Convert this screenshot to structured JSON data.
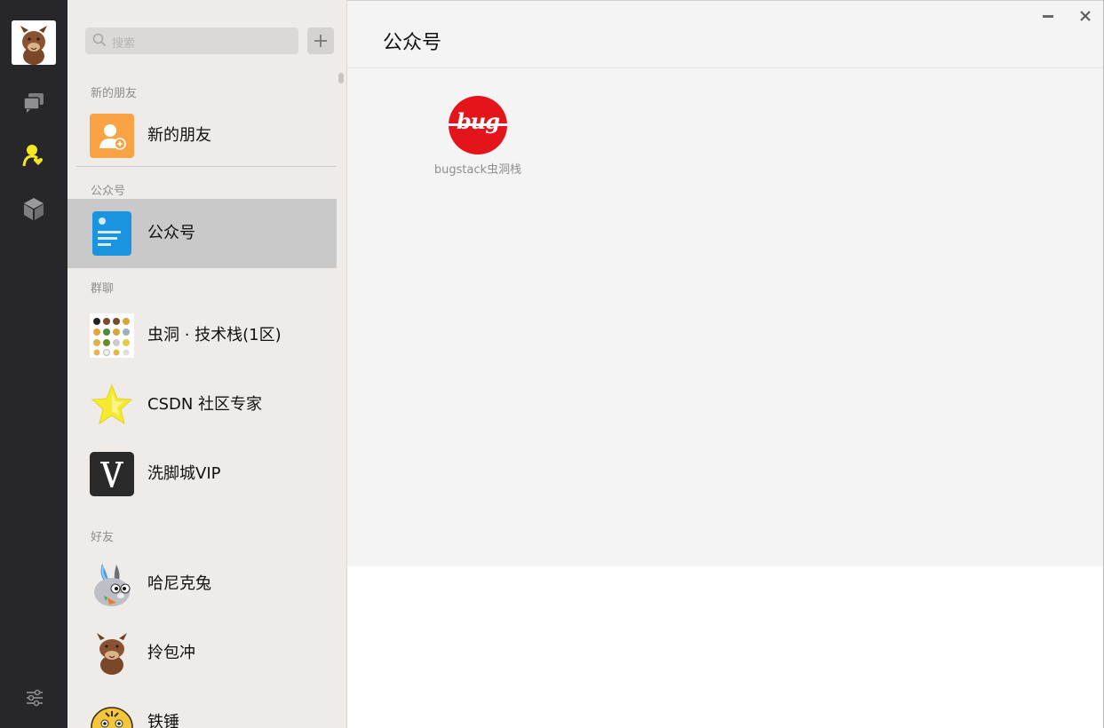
{
  "nav": {
    "items": [
      {
        "icon": "chat-bubbles-icon",
        "active": false
      },
      {
        "icon": "contacts-icon",
        "active": true
      },
      {
        "icon": "cube-icon",
        "active": false
      }
    ],
    "settings_icon": "settings-sliders-icon",
    "active_color": "#f5e623",
    "icon_color": "#8a8a8e"
  },
  "search": {
    "placeholder": "搜索"
  },
  "sections": {
    "new_friends": "新的朋友",
    "official": "公众号",
    "groups": "群聊",
    "friends": "好友"
  },
  "rows": {
    "new_friend": "新的朋友",
    "official_account": "公众号",
    "group1": "虫洞 · 技术栈(1区)",
    "group2": "CSDN 社区专家",
    "group3": "洗脚城VIP",
    "friend1": "哈尼克兔",
    "friend2": "拎包冲",
    "friend3": "铁锤"
  },
  "content": {
    "title": "公众号",
    "account": {
      "logo_text": "bug",
      "name": "bugstack虫洞栈"
    }
  },
  "window": {
    "minimize": "minimize-icon",
    "close": "close-icon"
  }
}
